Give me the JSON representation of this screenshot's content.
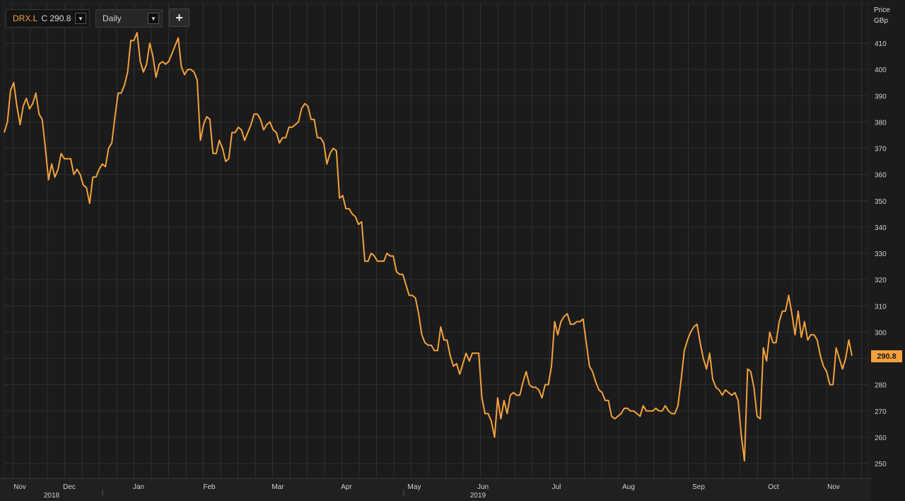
{
  "toolbar": {
    "symbol": "DRX.L",
    "close_text": "C 290.8",
    "interval": "Daily",
    "add_label": "+",
    "dropdown_icon": "chevron-down-icon",
    "add_icon": "plus-icon"
  },
  "axis": {
    "price_label": "Price",
    "currency_label": "GBp"
  },
  "colors": {
    "background": "#1b1b1b",
    "grid": "#2f2f2f",
    "line": "#f3a13c",
    "text": "#cfcfcf"
  },
  "chart_data": {
    "type": "line",
    "title": "",
    "ylabel": "Price GBp",
    "ylim": [
      244,
      416
    ],
    "yticks": [
      250,
      260,
      270,
      280,
      290,
      300,
      310,
      320,
      330,
      340,
      350,
      360,
      370,
      380,
      390,
      400,
      410
    ],
    "x_month_labels": [
      "Nov",
      "Dec",
      "Jan",
      "Feb",
      "Mar",
      "Apr",
      "May",
      "Jun",
      "Jul",
      "Aug",
      "Sep",
      "Oct",
      "Nov"
    ],
    "x_year_labels": [
      "2018",
      "2019"
    ],
    "grid": true,
    "last_value": "290.8",
    "series": [
      {
        "values": [
          376,
          380,
          392,
          395,
          386,
          379,
          386,
          389,
          385,
          387,
          391,
          383,
          381,
          370,
          358,
          364,
          359,
          362,
          368,
          366,
          366,
          366,
          360,
          362,
          360,
          356,
          355,
          349,
          359,
          359,
          362,
          364,
          363,
          370,
          372,
          382,
          391,
          391,
          394,
          399,
          411,
          411,
          414,
          403,
          399,
          402,
          410,
          405,
          397,
          402,
          403,
          402,
          403,
          406,
          409,
          412,
          401,
          398,
          400,
          400,
          399,
          396,
          373,
          379,
          382,
          381,
          368,
          368,
          373,
          370,
          365,
          366,
          376,
          376,
          378,
          377,
          373,
          376,
          379,
          383,
          383,
          381,
          377,
          379,
          380,
          377,
          376,
          372,
          374,
          374,
          378,
          378,
          379,
          380,
          385,
          387,
          386,
          381,
          381,
          374,
          374,
          372,
          364,
          368,
          370,
          369,
          351,
          352,
          347,
          347,
          345,
          344,
          341,
          342,
          327,
          327,
          330,
          329,
          327,
          327,
          327,
          330,
          329,
          329,
          323,
          322,
          322,
          318,
          314,
          314,
          313,
          307,
          299,
          296,
          295,
          295,
          293,
          293,
          302,
          297,
          297,
          291,
          287,
          288,
          284,
          288,
          292,
          289,
          292,
          292,
          292,
          275,
          269,
          269,
          266,
          260,
          275,
          267,
          274,
          269,
          276,
          277,
          276,
          276,
          281,
          285,
          280,
          279,
          279,
          278,
          275,
          280,
          280,
          287,
          304,
          299,
          304,
          306,
          307,
          303,
          303,
          304,
          304,
          305,
          296,
          287,
          285,
          281,
          278,
          277,
          274,
          274,
          268,
          267,
          268,
          269,
          271,
          271,
          270,
          270,
          269,
          268,
          272,
          270,
          270,
          270,
          271,
          270,
          270,
          272,
          270,
          269,
          269,
          272,
          282,
          293,
          297,
          300,
          302,
          303,
          296,
          290,
          286,
          292,
          282,
          279,
          278,
          276,
          278,
          277,
          276,
          277,
          274,
          261,
          251,
          286,
          285,
          279,
          268,
          267,
          294,
          289,
          300,
          296,
          296,
          304,
          308,
          308,
          314,
          307,
          299,
          308,
          298,
          304,
          297,
          299,
          299,
          297,
          291,
          287,
          285,
          280,
          280,
          294,
          290,
          286,
          290,
          297,
          291
        ]
      }
    ]
  }
}
